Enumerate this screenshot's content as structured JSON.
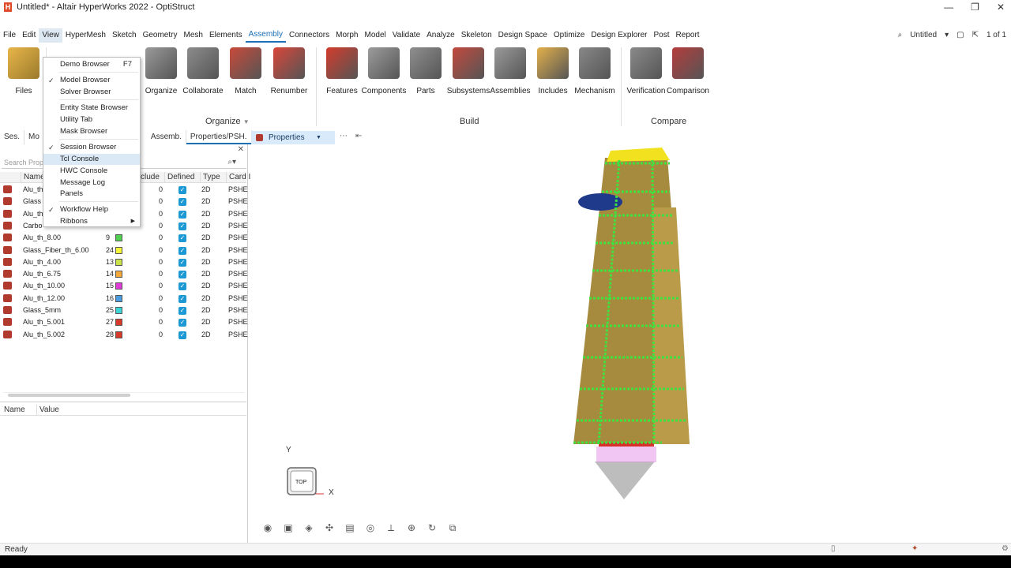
{
  "window": {
    "title": "Untitled* - Altair HyperWorks 2022 - OptiStruct",
    "controls": [
      "—",
      "❐",
      "✕"
    ]
  },
  "menubar": {
    "items": [
      "File",
      "Edit",
      "View",
      "HyperMesh",
      "Sketch",
      "Geometry",
      "Mesh",
      "Elements",
      "Assembly",
      "Connectors",
      "Morph",
      "Model",
      "Validate",
      "Analyze",
      "Skeleton",
      "Design Space",
      "Optimize",
      "Design Explorer",
      "Post",
      "Report"
    ],
    "active": "Assembly",
    "open": "View",
    "session_name": "Untitled",
    "page_indicator": "1 of 1"
  },
  "ribbon": {
    "files_label": "Files",
    "organize_tools": [
      "Organize",
      "Collaborate",
      "Match",
      "Renumber"
    ],
    "organize_group": "Organize",
    "build_tools": [
      "Features",
      "Components",
      "Parts",
      "Subsystems",
      "Assemblies",
      "Includes",
      "Mechanism"
    ],
    "build_group": "Build",
    "compare_tools": [
      "Verification",
      "Comparison"
    ],
    "compare_group": "Compare"
  },
  "browser": {
    "tabs": [
      "Ses.",
      "Mo",
      "Assemb.",
      "Properties/PSH."
    ],
    "properties_dropdown": "Properties",
    "search_placeholder": "Search Prop",
    "columns": [
      "Name",
      "clude",
      "Defined",
      "Type",
      "Card I"
    ],
    "rows": [
      {
        "name": "Alu_th",
        "id": "",
        "color": "",
        "include": "0",
        "type": "2D",
        "card": "PSHE"
      },
      {
        "name": "Glass",
        "id": "",
        "color": "",
        "include": "0",
        "type": "2D",
        "card": "PSHE"
      },
      {
        "name": "Alu_th",
        "id": "",
        "color": "",
        "include": "0",
        "type": "2D",
        "card": "PSHE"
      },
      {
        "name": "Carbo",
        "id": "",
        "color": "",
        "include": "0",
        "type": "2D",
        "card": "PSHE"
      },
      {
        "name": "Alu_th_8.00",
        "id": "9",
        "color": "#4fd14f",
        "include": "0",
        "type": "2D",
        "card": "PSHE"
      },
      {
        "name": "Glass_Fiber_th_6.00",
        "id": "24",
        "color": "#f4f43a",
        "include": "0",
        "type": "2D",
        "card": "PSHE"
      },
      {
        "name": "Alu_th_4.00",
        "id": "13",
        "color": "#c9e24a",
        "include": "0",
        "type": "2D",
        "card": "PSHE"
      },
      {
        "name": "Alu_th_6.75",
        "id": "14",
        "color": "#f4a93a",
        "include": "0",
        "type": "2D",
        "card": "PSHE"
      },
      {
        "name": "Alu_th_10.00",
        "id": "15",
        "color": "#e03ad8",
        "include": "0",
        "type": "2D",
        "card": "PSHE"
      },
      {
        "name": "Alu_th_12.00",
        "id": "16",
        "color": "#4a9be0",
        "include": "0",
        "type": "2D",
        "card": "PSHE"
      },
      {
        "name": "Glass_5mm",
        "id": "25",
        "color": "#3ad4d4",
        "include": "0",
        "type": "2D",
        "card": "PSHE"
      },
      {
        "name": "Alu_th_5.001",
        "id": "27",
        "color": "#d83a2a",
        "include": "0",
        "type": "2D",
        "card": "PSHE"
      },
      {
        "name": "Alu_th_5.002",
        "id": "28",
        "color": "#d83a2a",
        "include": "0",
        "type": "2D",
        "card": "PSHE"
      }
    ],
    "nv_columns": [
      "Name",
      "Value"
    ]
  },
  "view_menu": {
    "items": [
      {
        "label": "Demo Browser",
        "shortcut": "F7",
        "checked": false
      },
      {
        "label": "Model Browser",
        "checked": true
      },
      {
        "label": "Solver Browser",
        "checked": false
      },
      {
        "label": "Entity State Browser",
        "checked": false
      },
      {
        "label": "Utility Tab",
        "checked": false
      },
      {
        "label": "Mask Browser",
        "checked": false
      },
      {
        "label": "Session Browser",
        "checked": true
      },
      {
        "label": "Tcl Console",
        "checked": false,
        "highlighted": true
      },
      {
        "label": "HWC Console",
        "checked": false
      },
      {
        "label": "Message Log",
        "checked": false
      },
      {
        "label": "Panels",
        "checked": false
      },
      {
        "label": "Workflow Help",
        "checked": true
      },
      {
        "label": "Ribbons",
        "checked": false,
        "submenu": true
      }
    ]
  },
  "viewport": {
    "axis_y": "Y",
    "axis_x": "X",
    "view_cube_label": "TOP"
  },
  "status": {
    "text": "Ready"
  }
}
